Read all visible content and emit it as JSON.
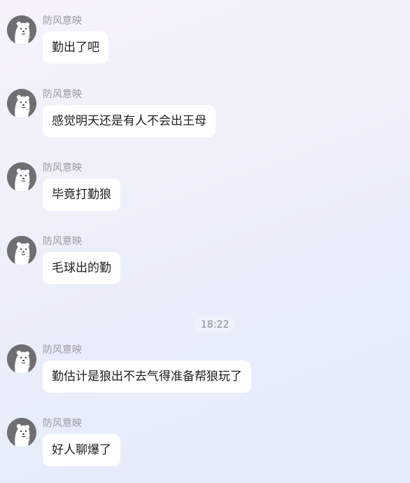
{
  "messages": [
    {
      "sender": "防风意映",
      "text": "勤出了吧",
      "avatar_icon": "polar-bear-avatar-icon"
    },
    {
      "sender": "防风意映",
      "text": "感觉明天还是有人不会出王母",
      "avatar_icon": "polar-bear-avatar-icon"
    },
    {
      "sender": "防风意映",
      "text": "毕竟打勤狼",
      "avatar_icon": "polar-bear-avatar-icon"
    },
    {
      "sender": "防风意映",
      "text": "毛球出的勤",
      "avatar_icon": "polar-bear-avatar-icon"
    },
    {
      "sender": "防风意映",
      "text": "勤估计是狼出不去气得准备帮狼玩了",
      "avatar_icon": "polar-bear-avatar-icon"
    },
    {
      "sender": "防风意映",
      "text": "好人聊爆了",
      "avatar_icon": "polar-bear-avatar-icon"
    }
  ],
  "timestamp": "18:22",
  "colors": {
    "bubble": "#ffffff",
    "sender_text": "#9a9aa2",
    "message_text": "#1e1e1e",
    "avatar_bg": "#6e6e73"
  }
}
